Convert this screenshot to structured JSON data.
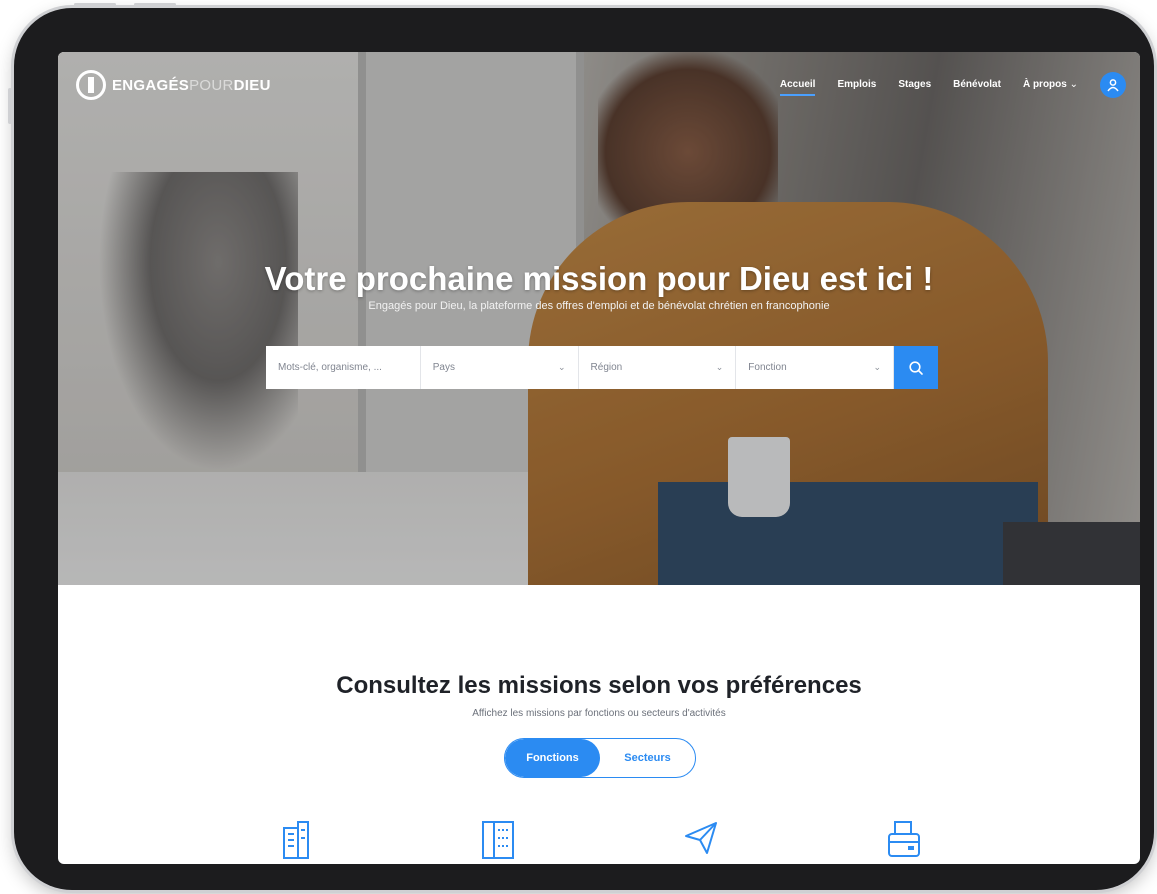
{
  "nav": {
    "logo": {
      "part1": "ENGAGÉS",
      "part2": "POUR",
      "part3": "DIEU"
    },
    "items": [
      "Accueil",
      "Emplois",
      "Stages",
      "Bénévolat",
      "À propos"
    ],
    "active": "Accueil"
  },
  "hero": {
    "title": "Votre prochaine mission pour Dieu est ici !",
    "subtitle": "Engagés pour Dieu, la plateforme des offres d'emploi et de bénévolat chrétien en francophonie"
  },
  "search": {
    "keyword_placeholder": "Mots-clé, organisme, ...",
    "country_placeholder": "Pays",
    "region_placeholder": "Région",
    "function_placeholder": "Fonction"
  },
  "section": {
    "title": "Consultez les missions selon vos préférences",
    "subtitle": "Affichez les missions par fonctions ou secteurs d'activités",
    "toggle": [
      "Fonctions",
      "Secteurs"
    ]
  },
  "colors": {
    "accent": "#2b8bf2",
    "heading": "#1f2228"
  },
  "icons": [
    "user-icon",
    "search-icon",
    "building-icon",
    "book-icon",
    "paper-plane-icon",
    "printer-icon"
  ]
}
